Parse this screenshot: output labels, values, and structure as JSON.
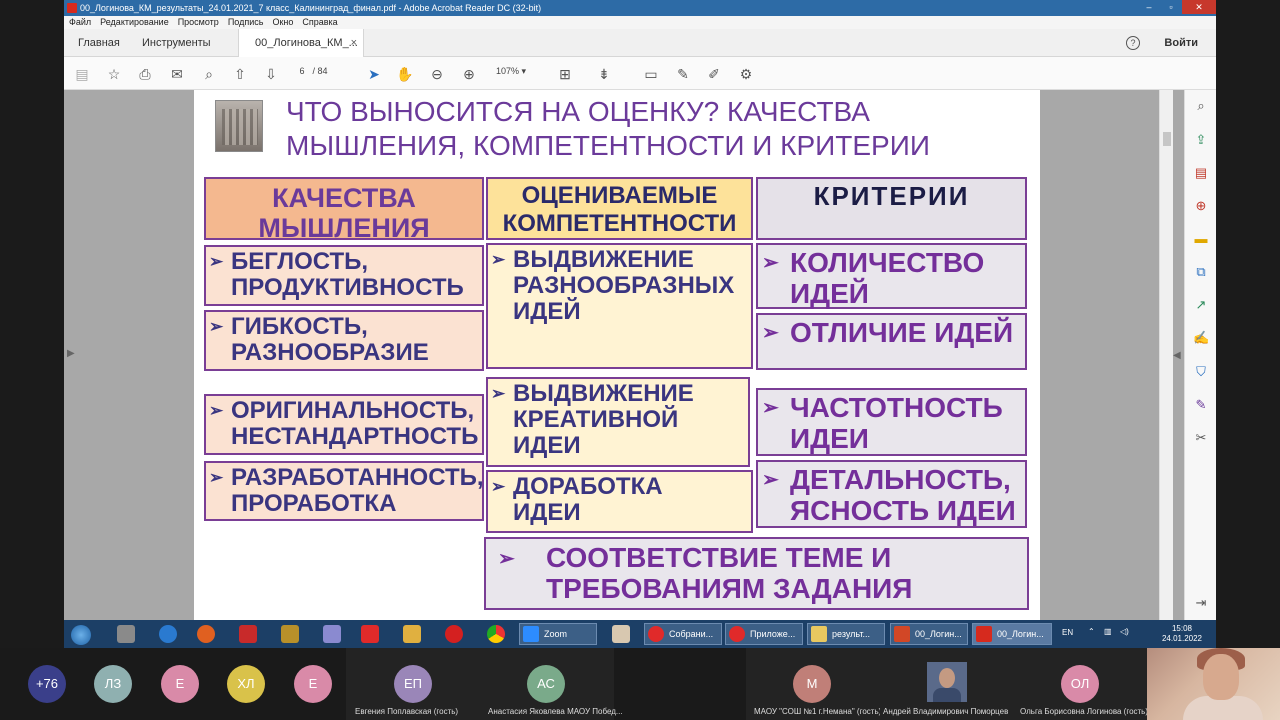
{
  "window": {
    "title": "00_Логинова_КМ_результаты_24.01.2021_7 класс_Калининград_финал.pdf - Adobe Acrobat Reader DC (32-bit)"
  },
  "menu": [
    "Файл",
    "Редактирование",
    "Просмотр",
    "Подпись",
    "Окно",
    "Справка"
  ],
  "tabs": {
    "home": "Главная",
    "tools": "Инструменты",
    "doc": "00_Логинова_КМ_...",
    "close": "×",
    "help": "?",
    "signin": "Войти"
  },
  "toolbar": {
    "page_current": "6",
    "page_total": "/ 84",
    "zoom": "107%"
  },
  "slide": {
    "title_line1": "ЧТО ВЫНОСИТСЯ НА ОЦЕНКУ? КАЧЕСТВА",
    "title_line2": "МЫШЛЕНИЯ, КОМПЕТЕНТНОСТИ И КРИТЕРИИ",
    "headers": {
      "col1": [
        "КАЧЕСТВА",
        "МЫШЛЕНИЯ"
      ],
      "col2": [
        "ОЦЕНИВАЕМЫЕ",
        "КОМПЕТЕНТНОСТИ"
      ],
      "col3": "КРИТЕРИИ"
    },
    "qualities": [
      [
        "БЕГЛОСТЬ,",
        "ПРОДУКТИВНОСТЬ"
      ],
      [
        "ГИБКОСТЬ,",
        "РАЗНООБРАЗИЕ"
      ],
      [
        "ОРИГИНАЛЬНОСТЬ,",
        "НЕСТАНДАРТНОСТЬ"
      ],
      [
        "РАЗРАБОТАННОСТЬ,",
        "ПРОРАБОТКА"
      ]
    ],
    "competences": [
      [
        "ВЫДВИЖЕНИЕ",
        "РАЗНООБРАЗНЫХ",
        "ИДЕЙ"
      ],
      [
        "ВЫДВИЖЕНИЕ",
        "КРЕАТИВНОЙ",
        "ИДЕИ"
      ],
      [
        "ДОРАБОТКА",
        "ИДЕИ"
      ]
    ],
    "criteria": [
      [
        "КОЛИЧЕСТВО",
        "ИДЕЙ"
      ],
      [
        "ОТЛИЧИЕ ИДЕЙ"
      ],
      [
        "ЧАСТОТНОСТЬ",
        "ИДЕИ"
      ],
      [
        "ДЕТАЛЬНОСТЬ,",
        "ЯСНОСТЬ ИДЕИ"
      ]
    ],
    "bottom": [
      "СООТВЕТСТВИЕ ТЕМЕ И",
      "ТРЕБОВАНИЯМ ЗАДАНИЯ"
    ]
  },
  "taskbar": {
    "buttons": [
      "Zoom",
      "Собрани...",
      "Приложе...",
      "результ...",
      "00_Логин...",
      "00_Логин..."
    ],
    "lang": "EN",
    "time": "15:08",
    "date": "24.01.2022"
  },
  "participants": {
    "more": "+76",
    "tiles": [
      {
        "initials": "ЛЗ",
        "color": "#8fb0b0"
      },
      {
        "initials": "Е",
        "color": "#d98aa8"
      },
      {
        "initials": "ХЛ",
        "color": "#d9c24a"
      },
      {
        "initials": "Е",
        "color": "#d98aa8"
      },
      {
        "initials": "ЕП",
        "color": "#9a86b8",
        "name": "Евгения Поплавская (гость)"
      },
      {
        "initials": "АС",
        "color": "#7aaa8a",
        "name": "Анастасия Яковлева МАОУ Побед..."
      },
      {
        "initials": "М",
        "color": "#c07f78",
        "name": "МАОУ \"СОШ №1 г.Немана\" (гость)"
      },
      {
        "initials": "",
        "name": "Андрей Владимирович Поморцев"
      },
      {
        "initials": "ОЛ",
        "color": "#d98aa8",
        "name": "Ольга Борисовна Логинова (гость)"
      }
    ]
  }
}
